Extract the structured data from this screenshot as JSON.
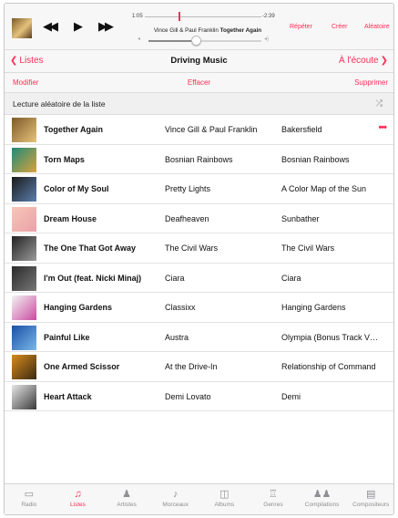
{
  "now_playing": {
    "elapsed": "1:05",
    "remaining": "-2:39",
    "artist": "Vince Gill & Paul Franklin",
    "title": "Together Again",
    "repeat_label": "Répéter",
    "create_label": "Créer",
    "shuffle_label": "Aléatoire",
    "progress_fraction": 0.29,
    "volume_fraction": 0.42
  },
  "nav": {
    "back_label": "Listes",
    "title": "Driving Music",
    "forward_label": "À l'écoute"
  },
  "edit": {
    "modify_label": "Modifier",
    "clear_label": "Effacer",
    "delete_label": "Supprimer"
  },
  "shuffle_row": {
    "label": "Lecture aléatoire de la liste",
    "icon": "shuffle-icon"
  },
  "songs": [
    {
      "title": "Together Again",
      "artist": "Vince Gill & Paul Franklin",
      "album": "Bakersfield",
      "art_colors": [
        "#7d5a2a",
        "#e7c27a"
      ],
      "more": "•••"
    },
    {
      "title": "Torn Maps",
      "artist": "Bosnian Rainbows",
      "album": "Bosnian Rainbows",
      "art_colors": [
        "#1f8a7a",
        "#d9a23a"
      ]
    },
    {
      "title": "Color of My Soul",
      "artist": "Pretty Lights",
      "album": "A Color Map of the Sun",
      "art_colors": [
        "#1a1a1a",
        "#5b7fae"
      ]
    },
    {
      "title": "Dream House",
      "artist": "Deafheaven",
      "album": "Sunbather",
      "art_colors": [
        "#f7c6b7",
        "#eaa1a8"
      ]
    },
    {
      "title": "The One That Got Away",
      "artist": "The Civil Wars",
      "album": "The Civil Wars",
      "art_colors": [
        "#222222",
        "#9a9a9a"
      ]
    },
    {
      "title": "I'm Out (feat. Nicki Minaj)",
      "artist": "Ciara",
      "album": "Ciara",
      "art_colors": [
        "#2a2a2a",
        "#777777"
      ]
    },
    {
      "title": "Hanging Gardens",
      "artist": "Classixx",
      "album": "Hanging Gardens",
      "art_colors": [
        "#f4f4f4",
        "#c94aa0"
      ]
    },
    {
      "title": "Painful Like",
      "artist": "Austra",
      "album": "Olympia (Bonus Track V…",
      "art_colors": [
        "#1b4fa6",
        "#79b8e8"
      ]
    },
    {
      "title": "One Armed Scissor",
      "artist": "At the Drive-In",
      "album": "Relationship of Command",
      "art_colors": [
        "#d88a1c",
        "#3a2a12"
      ]
    },
    {
      "title": "Heart Attack",
      "artist": "Demi Lovato",
      "album": "Demi",
      "art_colors": [
        "#e6e6e6",
        "#3a3a3a"
      ]
    }
  ],
  "tabs": [
    {
      "label": "Radio",
      "icon": "radio-icon",
      "glyph": "▭"
    },
    {
      "label": "Listes",
      "icon": "playlists-icon",
      "glyph": "♫",
      "active": true
    },
    {
      "label": "Artistes",
      "icon": "artists-icon",
      "glyph": "♟"
    },
    {
      "label": "Morceaux",
      "icon": "songs-icon",
      "glyph": "♪"
    },
    {
      "label": "Albums",
      "icon": "albums-icon",
      "glyph": "◫"
    },
    {
      "label": "Genres",
      "icon": "genres-icon",
      "glyph": "♖"
    },
    {
      "label": "Compilations",
      "icon": "compilations-icon",
      "glyph": "♟♟"
    },
    {
      "label": "Compositeurs",
      "icon": "composers-icon",
      "glyph": "▤"
    }
  ],
  "colors": {
    "accent": "#ff2d55",
    "inactive_tab": "#8e8e93"
  }
}
